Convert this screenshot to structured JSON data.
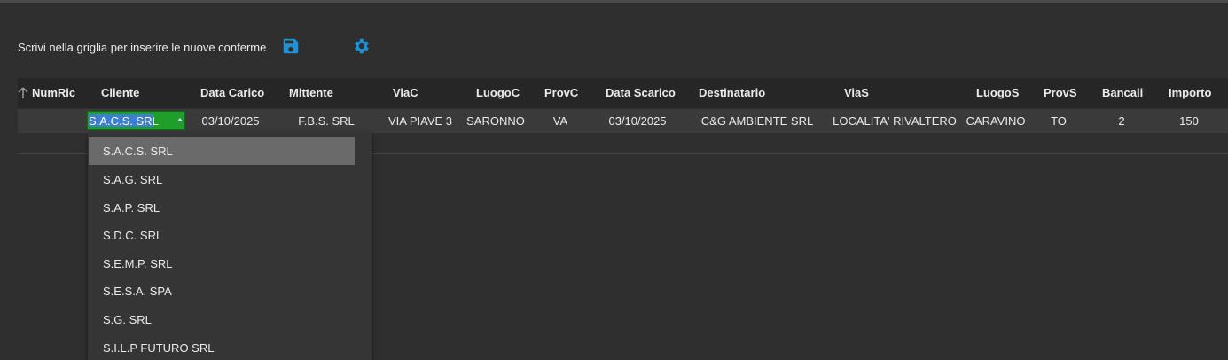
{
  "toolbar": {
    "hint": "Scrivi nella griglia per inserire le nuove conferme",
    "save_icon": "save-icon",
    "settings_icon": "gear-icon",
    "accent_color": "#1e90d6"
  },
  "grid": {
    "columns": [
      "NumRic",
      "Cliente",
      "Data Carico",
      "Mittente",
      "ViaC",
      "LuogoC",
      "ProvC",
      "Data Scarico",
      "Destinatario",
      "ViaS",
      "LuogoS",
      "ProvS",
      "Bancali",
      "Importo"
    ],
    "row": {
      "numric": "",
      "cliente": "S.A.C.S. SRL",
      "data_carico": "03/10/2025",
      "mittente": "F.B.S. SRL",
      "viac": "VIA PIAVE 3",
      "luogoc": "SARONNO",
      "provc": "VA",
      "data_scarico": "03/10/2025",
      "destinatario": "C&G AMBIENTE SRL",
      "vias": "LOCALITA' RIVALTERO",
      "luogos": "CARAVINO",
      "provs": "TO",
      "bancali": "2",
      "importo": "150"
    },
    "editor_color": "#1f9e2a"
  },
  "dropdown": {
    "options": [
      "S.A.C.S. SRL",
      "S.A.G. SRL",
      "S.A.P. SRL",
      "S.D.C. SRL",
      "S.E.M.P. SRL",
      "S.E.S.A. SPA",
      "S.G. SRL",
      "S.I.L.P FUTURO SRL"
    ],
    "selected": "S.A.C.S. SRL"
  }
}
